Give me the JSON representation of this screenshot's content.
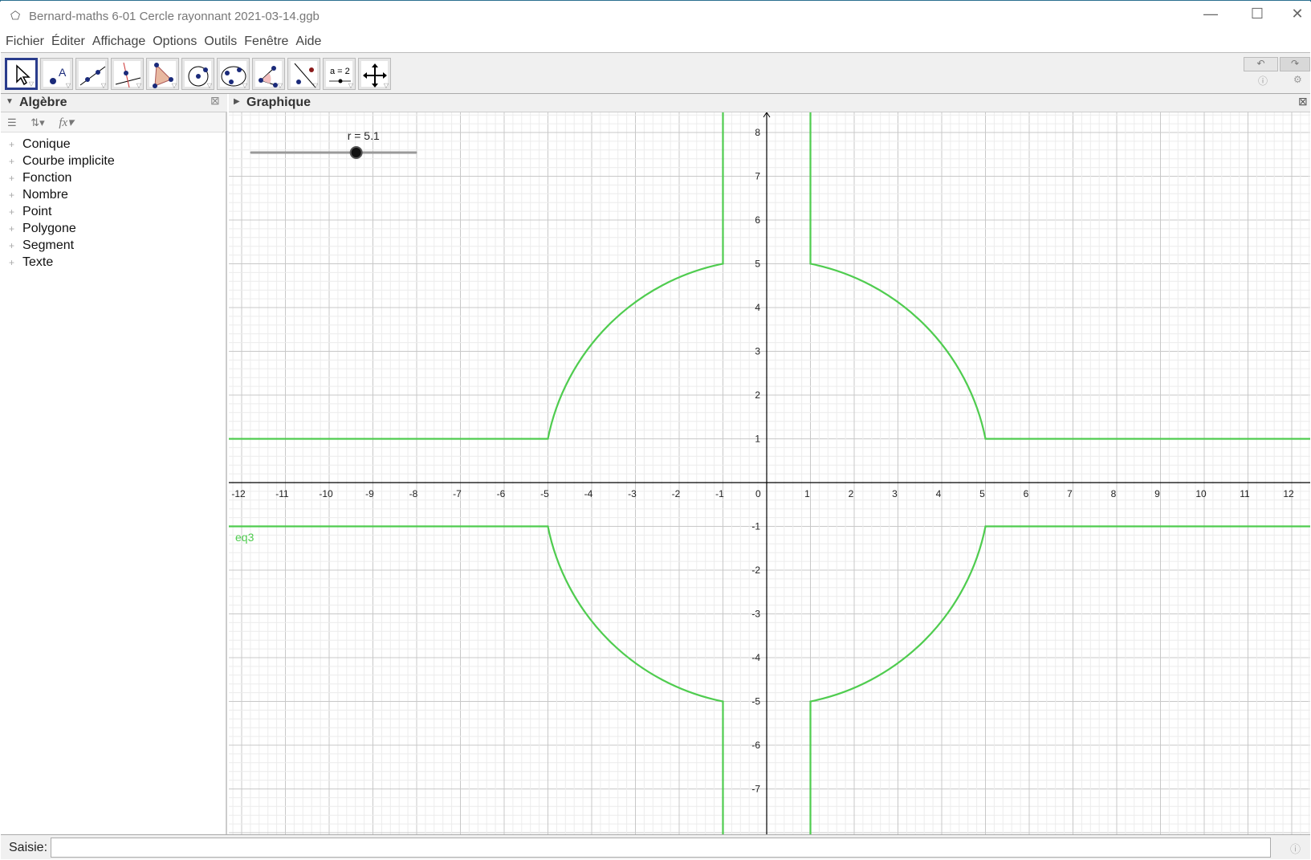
{
  "window": {
    "title": "Bernard-maths 6-01 Cercle rayonnant 2021-03-14.ggb"
  },
  "menu": [
    "Fichier",
    "Éditer",
    "Affichage",
    "Options",
    "Outils",
    "Fenêtre",
    "Aide"
  ],
  "toolbar": {
    "tools": [
      "move",
      "point",
      "line",
      "perpendicular",
      "polygon",
      "circle-center",
      "conic",
      "angle",
      "reflect",
      "slider",
      "move-graphics"
    ],
    "slider_icon_label": "a = 2"
  },
  "algebra": {
    "title": "Algèbre",
    "items": [
      "Conique",
      "Courbe implicite",
      "Fonction",
      "Nombre",
      "Point",
      "Polygone",
      "Segment",
      "Texte"
    ]
  },
  "graphics": {
    "title": "Graphique",
    "slider": {
      "label": "r = 5.1",
      "value": 5.1,
      "min": 0,
      "max": 8
    },
    "curve_label": "eq3",
    "curve_color": "#4fcc4f",
    "x_ticks": [
      -12,
      -11,
      -10,
      -9,
      -8,
      -7,
      -6,
      -5,
      -4,
      -3,
      -2,
      -1,
      0,
      1,
      2,
      3,
      4,
      5,
      6,
      7,
      8,
      9,
      10,
      11,
      12
    ],
    "y_ticks": [
      -7,
      -6,
      -5,
      -4,
      -3,
      -2,
      -1,
      1,
      2,
      3,
      4,
      5,
      6,
      7,
      8
    ]
  },
  "input": {
    "label": "Saisie:",
    "value": ""
  }
}
